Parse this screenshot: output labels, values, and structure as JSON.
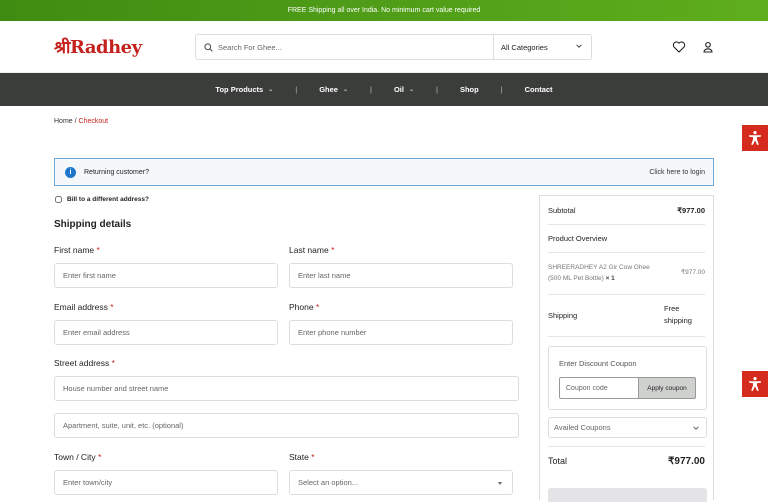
{
  "topbar": {
    "text": "FREE Shipping all over India. No minimum cart value required"
  },
  "header": {
    "logo_text": "Radhey",
    "logo_prefix": "श्री",
    "search_placeholder": "Search For Ghee...",
    "category_selected": "All Categories",
    "icons": [
      "search-icon",
      "chevron-down-icon",
      "heart-icon",
      "user-icon"
    ]
  },
  "nav": {
    "items": [
      {
        "label": "Top Products",
        "has_dropdown": true
      },
      {
        "label": "Ghee",
        "has_dropdown": true
      },
      {
        "label": "Oil",
        "has_dropdown": true
      },
      {
        "label": "Shop",
        "has_dropdown": false
      },
      {
        "label": "Contact",
        "has_dropdown": false
      }
    ],
    "separator": "|",
    "dropdown_glyph": "⌄"
  },
  "breadcrumb": {
    "home": "Home",
    "sep": " / ",
    "current": "Checkout"
  },
  "notice": {
    "icon": "info-icon",
    "text": "Returning customer?",
    "link": "Click here to login"
  },
  "billing": {
    "checkbox_label": "Bill to a different address?"
  },
  "shipping": {
    "title": "Shipping details",
    "required_mark": "*",
    "first_name": {
      "label": "First name",
      "placeholder": "Enter first name"
    },
    "last_name": {
      "label": "Last name",
      "placeholder": "Enter last name"
    },
    "email": {
      "label": "Email address",
      "placeholder": "Enter email address"
    },
    "phone": {
      "label": "Phone",
      "placeholder": "Enter phone number"
    },
    "street": {
      "label": "Street address",
      "placeholder1": "House number and street name",
      "placeholder2": "Apartment, suite, unit, etc. (optional)"
    },
    "city": {
      "label": "Town / City",
      "placeholder": "Enter town/city"
    },
    "state": {
      "label": "State",
      "placeholder": "Select an option..."
    }
  },
  "summary": {
    "subtotal_label": "Subtotal",
    "subtotal_value": "₹977.00",
    "overview_label": "Product Overview",
    "product_name": "SHREERADHEY A2 Gir Cow Ghee (500 ML Pet Bottle)",
    "product_qty": "× 1",
    "product_price": "₹977.00",
    "shipping_label": "Shipping",
    "shipping_value": "Free shipping",
    "coupon_title": "Enter Discount Coupon",
    "coupon_placeholder": "Coupon code",
    "coupon_button": "Apply coupon",
    "availed_label": "Availed Coupons",
    "total_label": "Total",
    "total_value": "₹977.00"
  },
  "colors": {
    "brand": "#c5221f",
    "topbar": "#4e9e18",
    "nav": "#3b3d3b",
    "accessibility": "#d42b1e",
    "notice_border": "#6aa9d8"
  }
}
